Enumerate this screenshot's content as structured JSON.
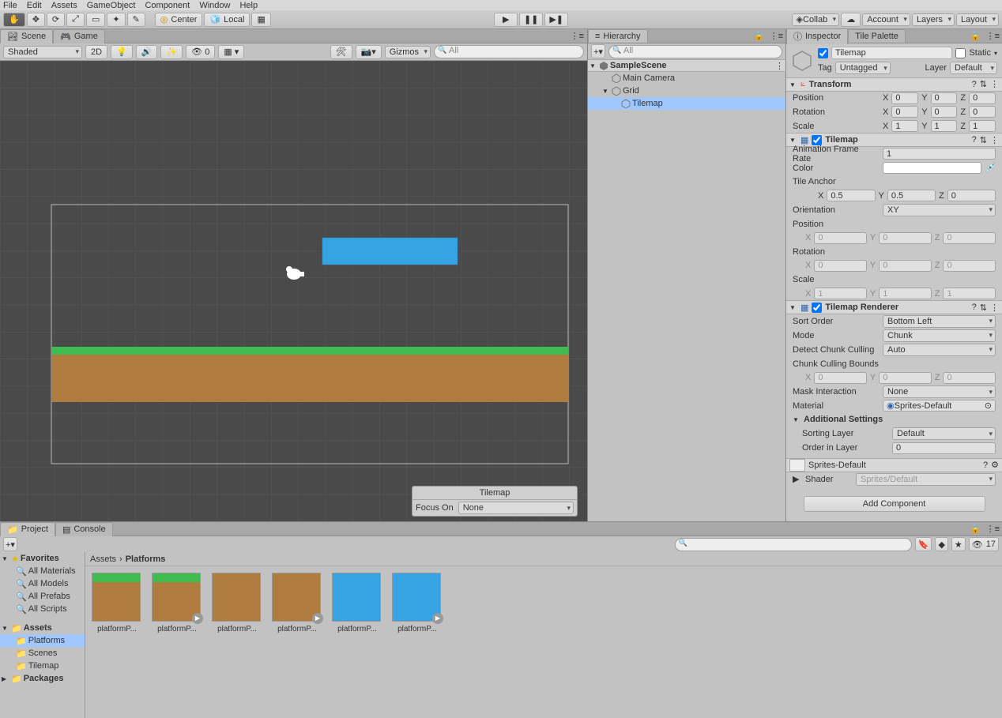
{
  "menubar": [
    "File",
    "Edit",
    "Assets",
    "GameObject",
    "Component",
    "Window",
    "Help"
  ],
  "toolbar": {
    "center": "Center",
    "local": "Local",
    "collab": "Collab",
    "account": "Account",
    "layers": "Layers",
    "layout": "Layout"
  },
  "sceneTab": "Scene",
  "gameTab": "Game",
  "sceneToolbar": {
    "shaded": "Shaded",
    "twoD": "2D",
    "gizmos": "Gizmos",
    "allSearch": "All"
  },
  "focusOverlay": {
    "title": "Tilemap",
    "focusOn": "Focus On",
    "none": "None"
  },
  "hierarchy": {
    "title": "Hierarchy",
    "search": "All",
    "root": "SampleScene",
    "items": [
      "Main Camera",
      "Grid",
      "Tilemap"
    ]
  },
  "inspector": {
    "title": "Inspector",
    "palette": "Tile Palette",
    "objName": "Tilemap",
    "static": "Static",
    "tagLabel": "Tag",
    "tag": "Untagged",
    "layerLabel": "Layer",
    "layer": "Default",
    "transform": {
      "title": "Transform",
      "position": "Position",
      "rotation": "Rotation",
      "scale": "Scale",
      "px": "0",
      "py": "0",
      "pz": "0",
      "rx": "0",
      "ry": "0",
      "rz": "0",
      "sx": "1",
      "sy": "1",
      "sz": "1"
    },
    "tilemap": {
      "title": "Tilemap",
      "animFrame": "Animation Frame Rate",
      "animVal": "1",
      "color": "Color",
      "tileAnchor": "Tile Anchor",
      "ax": "0.5",
      "ay": "0.5",
      "az": "0",
      "orientation": "Orientation",
      "orientVal": "XY",
      "position": "Position",
      "px": "0",
      "py": "0",
      "pz": "0",
      "rotation": "Rotation",
      "rx": "0",
      "ry": "0",
      "rz": "0",
      "scale": "Scale",
      "sx": "1",
      "sy": "1",
      "sz": "1"
    },
    "renderer": {
      "title": "Tilemap Renderer",
      "sortOrder": "Sort Order",
      "sortVal": "Bottom Left",
      "mode": "Mode",
      "modeVal": "Chunk",
      "detect": "Detect Chunk Culling",
      "detectVal": "Auto",
      "bounds": "Chunk Culling Bounds",
      "bx": "0",
      "by": "0",
      "bz": "0",
      "mask": "Mask Interaction",
      "maskVal": "None",
      "material": "Material",
      "matVal": "Sprites-Default",
      "additional": "Additional Settings",
      "sortingLayer": "Sorting Layer",
      "sortingVal": "Default",
      "orderLayer": "Order in Layer",
      "orderVal": "0"
    },
    "shaderBox": {
      "title": "Sprites-Default",
      "shader": "Shader",
      "shaderVal": "Sprites/Default"
    },
    "addComponent": "Add Component"
  },
  "project": {
    "title": "Project",
    "console": "Console",
    "hidden": "17",
    "favorites": "Favorites",
    "favItems": [
      "All Materials",
      "All Models",
      "All Prefabs",
      "All Scripts"
    ],
    "assets": "Assets",
    "folders": [
      "Platforms",
      "Scenes",
      "Tilemap"
    ],
    "packages": "Packages",
    "crumb1": "Assets",
    "crumb2": "Platforms",
    "items": [
      "platformP...",
      "platformP...",
      "platformP...",
      "platformP...",
      "platformP...",
      "platformP..."
    ]
  }
}
